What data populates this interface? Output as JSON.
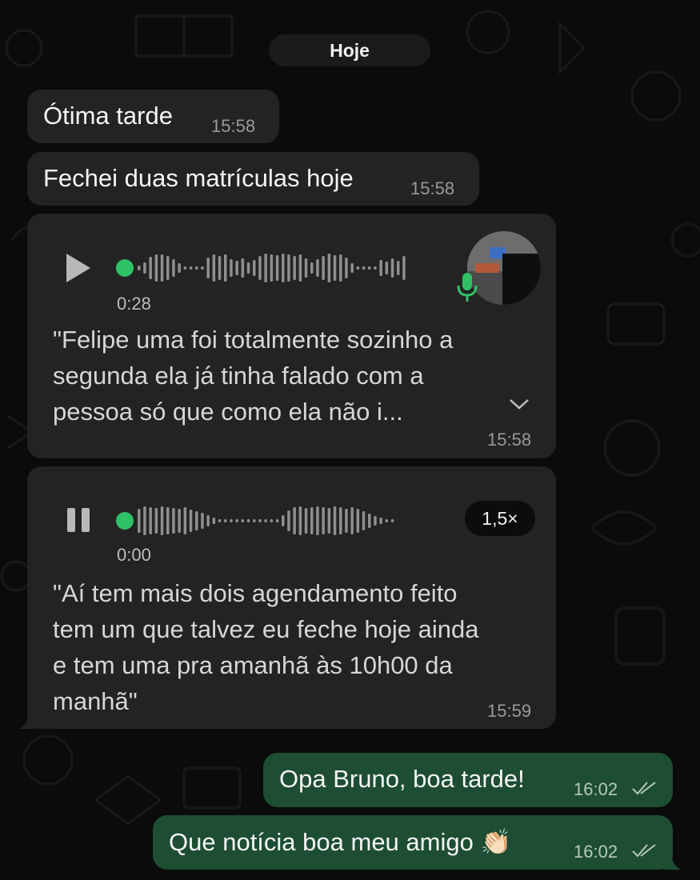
{
  "chat": {
    "date_label": "Hoje",
    "messages": [
      {
        "direction": "incoming",
        "type": "text",
        "text": "Ótima tarde",
        "time": "15:58"
      },
      {
        "direction": "incoming",
        "type": "text",
        "text": "Fechei duas matrículas hoje",
        "time": "15:58"
      },
      {
        "direction": "incoming",
        "type": "voice",
        "state": "paused",
        "duration": "0:28",
        "transcript": [
          "\"Felipe uma foi totalmente sozinho a",
          "segunda ela já tinha falado com a",
          "pessoa só que como ela não i..."
        ],
        "time": "15:58"
      },
      {
        "direction": "incoming",
        "type": "voice",
        "state": "playing",
        "duration": "0:00",
        "speed": "1,5×",
        "transcript": [
          "\"Aí tem mais dois agendamento feito",
          "tem um que talvez eu feche hoje ainda",
          "e tem uma pra amanhã às 10h00 da",
          "manhã\""
        ],
        "time": "15:59"
      },
      {
        "direction": "outgoing",
        "type": "text",
        "text": "Opa Bruno, boa tarde!",
        "time": "16:02",
        "status": "read"
      },
      {
        "direction": "outgoing",
        "type": "text",
        "text": "Que notícia boa meu amigo 👏🏻",
        "time": "16:02",
        "status": "read"
      }
    ]
  },
  "icons": {
    "play": "play-icon",
    "pause": "pause-icon",
    "mic": "microphone-icon",
    "expand": "chevron-down-icon",
    "read_receipt": "double-check-icon"
  },
  "colors": {
    "incoming_bubble": "#232323",
    "outgoing_bubble": "#1d4d33",
    "accent_green": "#2fc166",
    "background": "#0b0b0b"
  }
}
